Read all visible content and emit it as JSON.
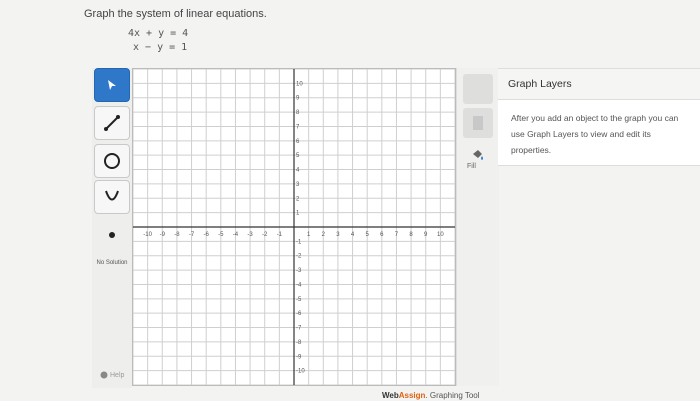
{
  "prompt": "Graph the system of linear equations.",
  "equations": [
    "4x + y = 4",
    "x − y = 1"
  ],
  "toolbar": {
    "tools": [
      {
        "name": "pointer-icon",
        "active": true
      },
      {
        "name": "line-icon"
      },
      {
        "name": "circle-icon"
      },
      {
        "name": "parabola-icon"
      },
      {
        "name": "point-icon"
      }
    ],
    "no_solution_label": "No Solution",
    "help_label": "Help"
  },
  "graph": {
    "xlim": [
      -11,
      11
    ],
    "ylim": [
      -11,
      11
    ],
    "x_tick_labels": [
      "-10",
      "-9",
      "-8",
      "-7",
      "-6",
      "-5",
      "-4",
      "-3",
      "-2",
      "-1",
      "1",
      "2",
      "3",
      "4",
      "5",
      "6",
      "7",
      "8",
      "9",
      "10"
    ],
    "y_tick_labels": [
      "10",
      "9",
      "8",
      "7",
      "6",
      "5",
      "4",
      "3",
      "2",
      "1",
      "-1",
      "-2",
      "-3",
      "-4",
      "-5",
      "-6",
      "-7",
      "-8",
      "-9",
      "-10"
    ],
    "grid": true
  },
  "side_tools": {
    "fill_label": "Fill",
    "icons": [
      "delete-icon",
      "trash-icon",
      "fill-icon"
    ]
  },
  "layers": {
    "title": "Graph Layers",
    "description": "After you add an object to the graph you can use Graph Layers to view and edit its properties."
  },
  "brand": {
    "part1": "Web",
    "part2": "Assign",
    "part3": ". Graphing Tool"
  },
  "colors": {
    "accent": "#2f77c9",
    "brand_orange": "#e06010",
    "axis": "#333333",
    "grid": "#cfcfcf"
  }
}
